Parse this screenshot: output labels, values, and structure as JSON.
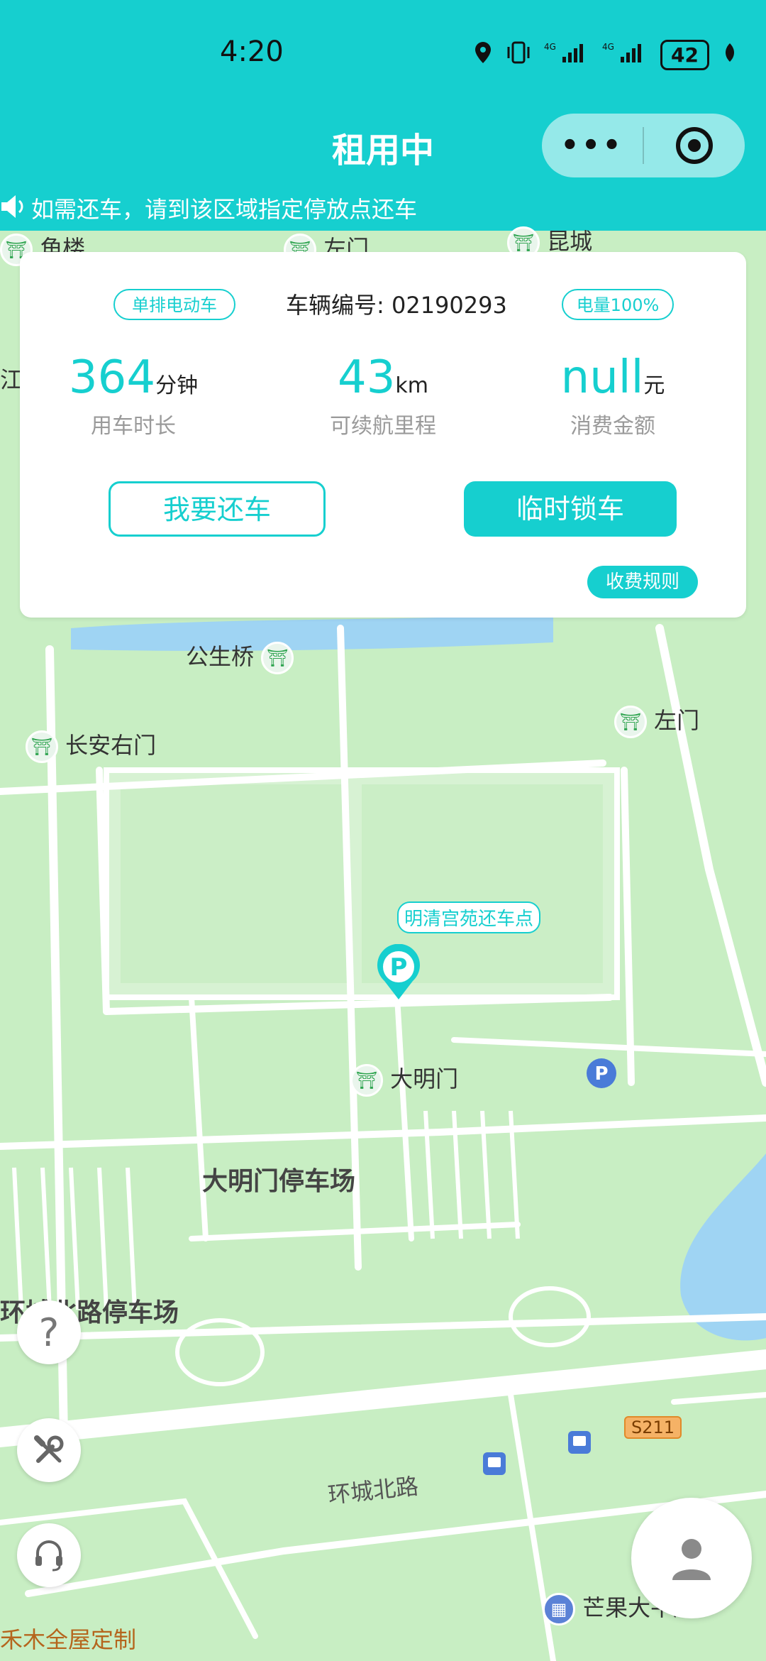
{
  "status_bar": {
    "time": "4:20",
    "battery": "42",
    "network": "4G"
  },
  "nav": {
    "title": "租用中",
    "more": "•••"
  },
  "notice": {
    "text": "如需还车，请到该区域指定停放点还车"
  },
  "card": {
    "vehicle_type_tag": "单排电动车",
    "vehicle_no_label": "车辆编号:",
    "vehicle_no": "02190293",
    "battery_tag": "电量100%",
    "stats": [
      {
        "value": "364",
        "unit": "分钟",
        "label": "用车时长"
      },
      {
        "value": "43",
        "unit": "km",
        "label": "可续航里程"
      },
      {
        "value": "null",
        "unit": "元",
        "label": "消费金额"
      }
    ],
    "return_button": "我要还车",
    "lock_button": "临时锁车",
    "rules_button": "收费规则"
  },
  "map": {
    "labels": {
      "jiaolou": "角楼",
      "zuomen_top": "左门",
      "kuncheng": "昆城",
      "jiang": "江",
      "gongshengqiao": "公生桥",
      "zuomen": "左门",
      "changanyoumen": "长安右门",
      "return_point": "明清宫苑还车点",
      "damingmen": "大明门",
      "damingmen_parking": "大明门停车场",
      "huanchengbeilu_parking": "环城北路停车场",
      "s211": "S211",
      "huanchengbeilu": "环城北路",
      "mangguo": "芒果大平层",
      "quanwu": "禾木全屋定制"
    }
  },
  "colors": {
    "accent": "#16cfcf",
    "map_bg": "#c8eec3",
    "road": "#ffffff",
    "water": "#9fd4f3"
  }
}
